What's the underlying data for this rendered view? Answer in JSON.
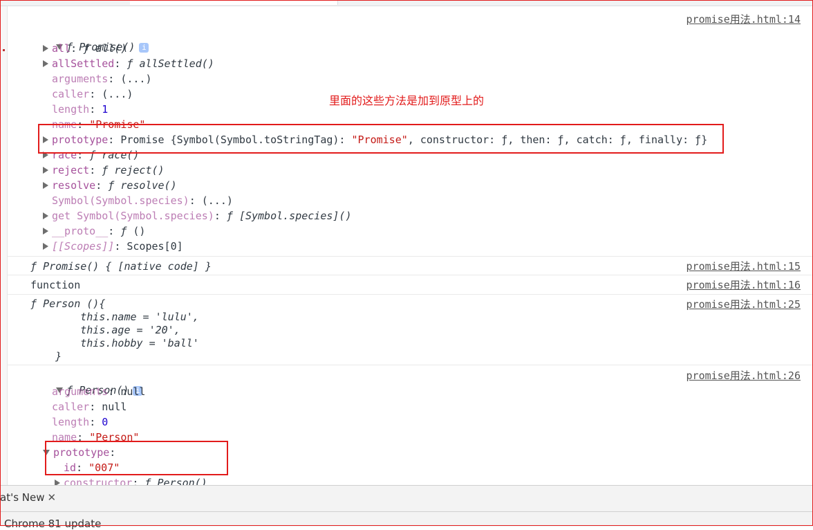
{
  "console": {
    "entry1": {
      "source": "promise用法.html:14",
      "head": "Promise()",
      "f": "ƒ",
      "props": [
        {
          "key": "all",
          "value": "all()"
        },
        {
          "key": "allSettled",
          "value": "allSettled()"
        },
        {
          "key": "arguments",
          "value": "(...)"
        },
        {
          "key": "caller",
          "value": "(...)"
        },
        {
          "key": "length",
          "value": "1"
        },
        {
          "key": "name",
          "value": "\"Promise\""
        },
        {
          "key": "prototype",
          "value": "Promise {Symbol(Symbol.toStringTag): ",
          "str": "\"Promise\"",
          "rest": ", constructor: ƒ, then: ƒ, catch: ƒ, finally: ƒ}"
        },
        {
          "key": "race",
          "value": "race()"
        },
        {
          "key": "reject",
          "value": "reject()"
        },
        {
          "key": "resolve",
          "value": "resolve()"
        },
        {
          "key": "Symbol(Symbol.species)",
          "value": "(...)"
        },
        {
          "key": "get Symbol(Symbol.species)",
          "value": "[Symbol.species]()"
        },
        {
          "key": "__proto__",
          "value": "()"
        },
        {
          "key": "[[Scopes]]",
          "value": "Scopes[0]"
        }
      ]
    },
    "entry2": {
      "text": "Promise() { [native code] }",
      "source": "promise用法.html:15"
    },
    "entry3": {
      "text": "function",
      "source": "promise用法.html:16"
    },
    "entry4": {
      "source": "promise用法.html:25",
      "lines": [
        "Person (){",
        "        this.name = 'lulu',",
        "        this.age = '20',",
        "        this.hobby = 'ball'",
        "    }"
      ]
    },
    "entry5": {
      "source": "promise用法.html:26",
      "head": "Person()",
      "props": [
        {
          "key": "arguments",
          "value": "null"
        },
        {
          "key": "caller",
          "value": "null"
        },
        {
          "key": "length",
          "value": "0"
        },
        {
          "key": "name",
          "value": "\"Person\""
        },
        {
          "key": "prototype",
          "value": ""
        },
        {
          "key": "id",
          "value": "\"007\""
        },
        {
          "key": "constructor",
          "value": "Person()"
        }
      ]
    }
  },
  "annotation": "里面的这些方法是加到原型上的",
  "drawer": {
    "tab_label": "at's New",
    "close": "✕",
    "body_text": "Chrome 81 update"
  },
  "colors": {
    "annotation": "#e21b1b",
    "key": "#a6529c",
    "string": "#c41a16",
    "number": "#1c00cf"
  }
}
